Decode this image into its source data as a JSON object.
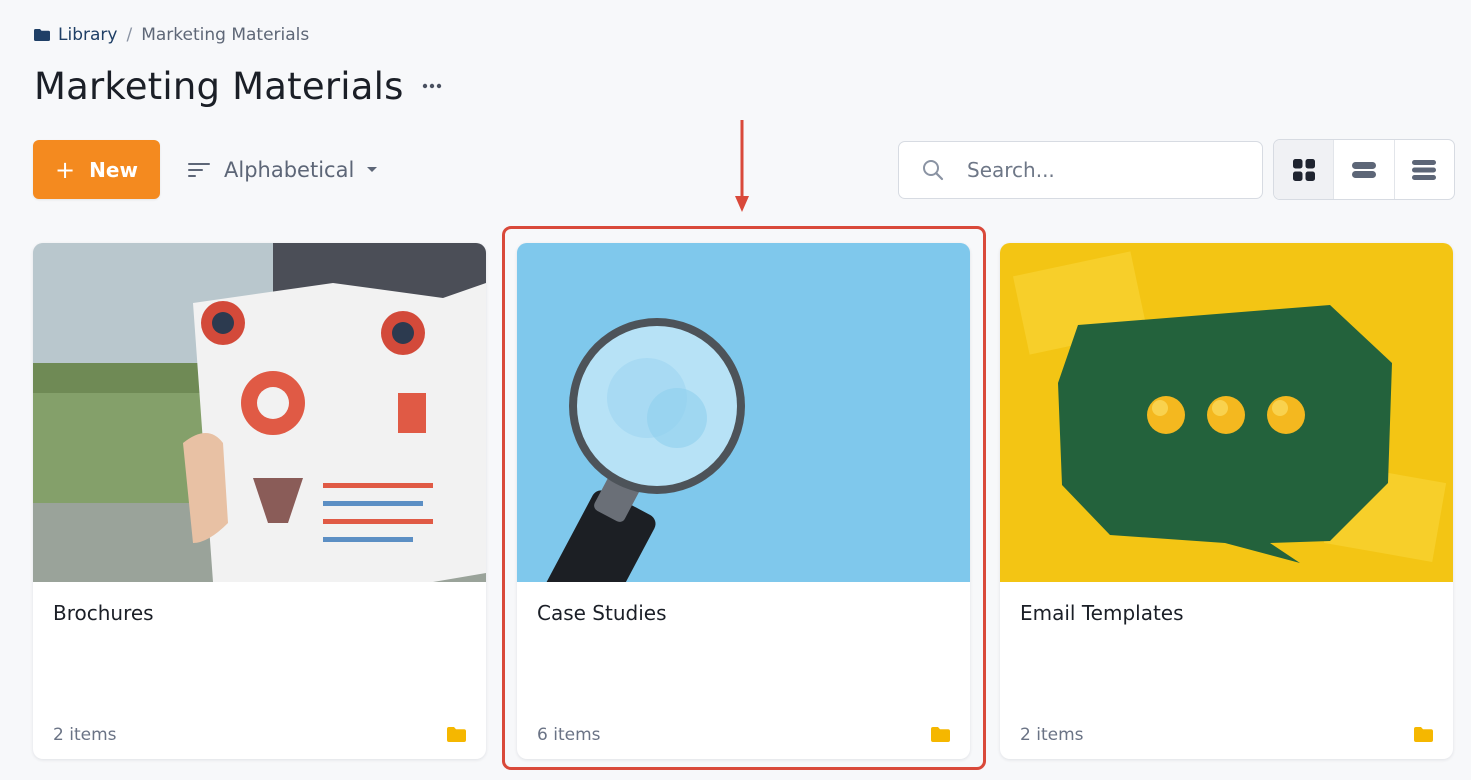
{
  "breadcrumb": {
    "root_label": "Library",
    "separator": "/",
    "current_label": "Marketing Materials"
  },
  "header": {
    "title": "Marketing Materials",
    "more_icon": "more-horizontal-icon"
  },
  "toolbar": {
    "new_label": "New",
    "sort_label": "Alphabetical",
    "search_placeholder": "Search...",
    "search_value": "",
    "view_modes": [
      "grid",
      "compact-list",
      "list"
    ],
    "active_view": "grid"
  },
  "colors": {
    "accent": "#f48a1f",
    "folder": "#f5b700",
    "highlight": "#d9493a",
    "breadcrumb_link": "#1f3f66"
  },
  "folders": [
    {
      "name": "Brochures",
      "count_label": "2 items",
      "thumbnail": "brochure-photo"
    },
    {
      "name": "Case Studies",
      "count_label": "6 items",
      "thumbnail": "magnifier-photo"
    },
    {
      "name": "Email Templates",
      "count_label": "2 items",
      "thumbnail": "speech-bubble-photo"
    }
  ]
}
